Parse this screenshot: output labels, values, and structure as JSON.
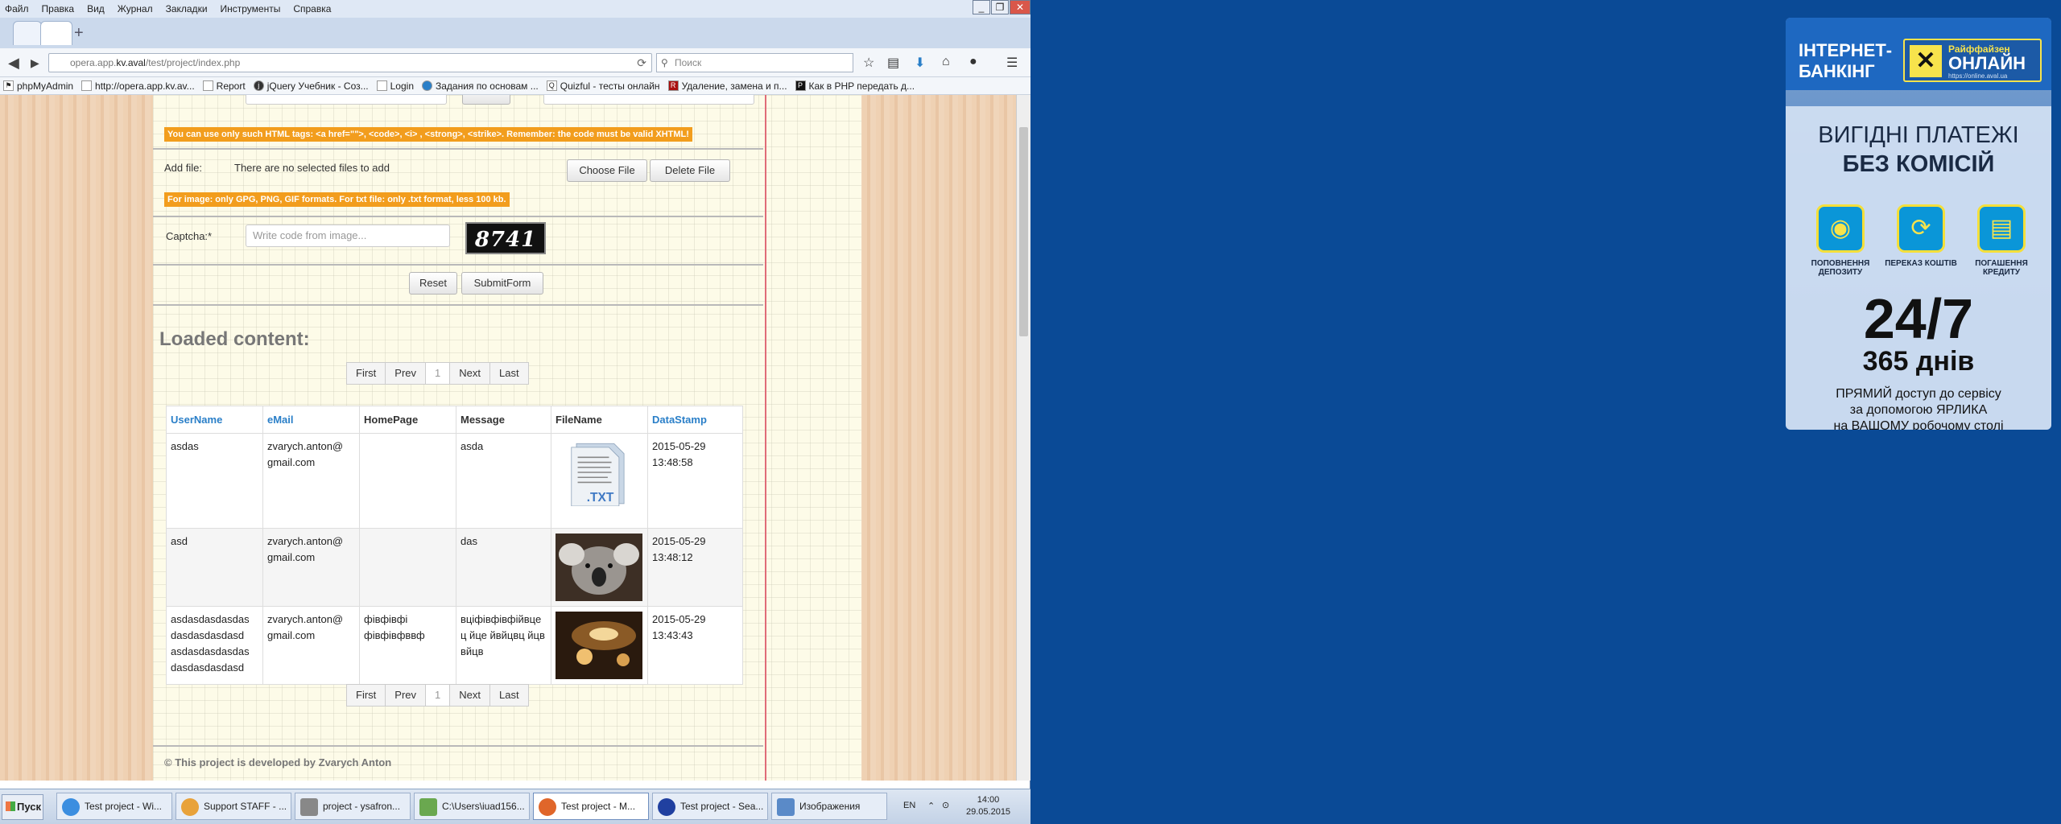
{
  "menubar": [
    "Файл",
    "Правка",
    "Вид",
    "Журнал",
    "Закладки",
    "Инструменты",
    "Справка"
  ],
  "url": {
    "prefix": "opera.app.",
    "host": "kv.aval",
    "path": "/test/project/index.php"
  },
  "search_placeholder": "Поиск",
  "bookmarks": [
    "phpMyAdmin",
    "http://opera.app.kv.av...",
    "Report",
    "jQuery Учебник - Соз...",
    "Login",
    "Задания по основам ...",
    "Quizful - тесты онлайн",
    "Удаление, замена и п...",
    "Как в PHP передать д..."
  ],
  "form": {
    "html_warning": "You can use only such HTML tags: <a href=\"\">, <code>, <i> , <strong>, <strike>. Remember: the code must be valid XHTML!",
    "addfile_label": "Add file:",
    "no_files": "There are no selected files to add",
    "choose_file": "Choose File",
    "delete_file": "Delete File",
    "image_warning": "For image: only GPG, PNG, GIF formats. For txt file: only .txt format, less 100 kb.",
    "captcha_label": "Captcha:*",
    "captcha_placeholder": "Write code from image...",
    "captcha_code": "8741",
    "reset": "Reset",
    "submit": "SubmitForm"
  },
  "loaded_title": "Loaded content:",
  "pager": {
    "first": "First",
    "prev": "Prev",
    "current": "1",
    "next": "Next",
    "last": "Last"
  },
  "table": {
    "headers": [
      "UserName",
      "eMail",
      "HomePage",
      "Message",
      "FileName",
      "DataStamp"
    ],
    "rows": [
      {
        "user": "asdas",
        "email": "zvarych.anton@ gmail.com",
        "home": "",
        "message": "asda",
        "file": "txt",
        "stamp": "2015-05-29 13:48:58"
      },
      {
        "user": "asd",
        "email": "zvarych.anton@ gmail.com",
        "home": "",
        "message": "das",
        "file": "koala",
        "stamp": "2015-05-29 13:48:12"
      },
      {
        "user": "asdasdasdasdas dasdasdasdasd asdasdasdasdas dasdasdasdasd",
        "email": "zvarych.anton@ gmail.com",
        "home": "фівфівфі фівфівфввф",
        "message": "вціфівфівфійвце ц йце йвйцвц йцв вйцв",
        "file": "lamp",
        "stamp": "2015-05-29 13:43:43"
      }
    ],
    "txt_label": ".TXT"
  },
  "footer": "©  This project is developed by Zvarych Anton",
  "ad": {
    "ib": "ІНТЕРНЕТ-\nБАНКІНГ",
    "logo_top": "Райффайзен",
    "logo_main": "ОНЛАЙН",
    "logo_url": "https://online.aval.ua",
    "h1a": "ВИГІДНІ ПЛАТЕЖІ",
    "h1b": "БЕЗ КОМІСІЙ",
    "services": [
      "ПОПОВНЕННЯ ДЕПОЗИТУ",
      "ПЕРЕКАЗ КОШТІВ",
      "ПОГАШЕННЯ КРЕДИТУ"
    ],
    "big": "24/7",
    "days": "365 днів",
    "foot1": "ПРЯМИЙ доступ до сервісу",
    "foot2": "за допомогою ЯРЛИКА",
    "foot3": "на ВАШОМУ робочому столі"
  },
  "taskbar": {
    "start": "Пуск",
    "tasks": [
      "Test project - Wi...",
      "Support STAFF - ...",
      "project - ysafron...",
      "C:\\Users\\iuad156...",
      "Test project - M...",
      "Test project - Sea...",
      "Изображения"
    ],
    "lang": "EN",
    "time": "14:00",
    "date": "29.05.2015"
  },
  "colors": {
    "accent_orange": "#f29d1d",
    "link_blue": "#2a7fc8",
    "desktop_blue": "#0a4a96"
  }
}
